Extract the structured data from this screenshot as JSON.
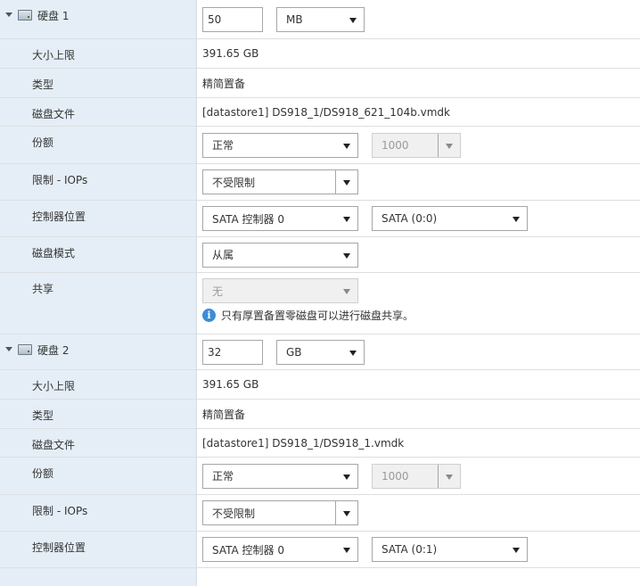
{
  "disk1": {
    "title": "硬盘 1",
    "size_value": "50",
    "size_unit": "MB",
    "rows": {
      "max_size": {
        "label": "大小上限",
        "value": "391.65 GB"
      },
      "type": {
        "label": "类型",
        "value": "精简置备"
      },
      "disk_file": {
        "label": "磁盘文件",
        "value": "[datastore1] DS918_1/DS918_621_104b.vmdk"
      },
      "shares": {
        "label": "份额",
        "select": "正常",
        "number": "1000"
      },
      "limit_iops": {
        "label": "限制 - IOPs",
        "select": "不受限制"
      },
      "controller": {
        "label": "控制器位置",
        "controller": "SATA 控制器 0",
        "port": "SATA (0:0)"
      },
      "disk_mode": {
        "label": "磁盘模式",
        "select": "从属"
      },
      "sharing": {
        "label": "共享",
        "select": "无",
        "info": "只有厚置备置零磁盘可以进行磁盘共享。"
      }
    }
  },
  "disk2": {
    "title": "硬盘 2",
    "size_value": "32",
    "size_unit": "GB",
    "rows": {
      "max_size": {
        "label": "大小上限",
        "value": "391.65 GB"
      },
      "type": {
        "label": "类型",
        "value": "精简置备"
      },
      "disk_file": {
        "label": "磁盘文件",
        "value": "[datastore1] DS918_1/DS918_1.vmdk"
      },
      "shares": {
        "label": "份额",
        "select": "正常",
        "number": "1000"
      },
      "limit_iops": {
        "label": "限制 - IOPs",
        "select": "不受限制"
      },
      "controller": {
        "label": "控制器位置",
        "controller": "SATA 控制器 0",
        "port": "SATA (0:1)"
      }
    }
  },
  "icons": {
    "expand": "caret-down-icon",
    "disk": "hard-disk-icon",
    "info": "info-icon"
  },
  "colors": {
    "label_bg": "#e5eef6",
    "info_blue": "#3d8cd9",
    "border": "#a6a6a6"
  }
}
